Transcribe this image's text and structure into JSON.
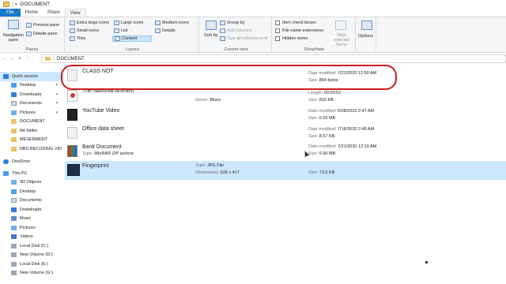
{
  "window": {
    "title": "DOCUMENT"
  },
  "tabs": [
    "File",
    "Home",
    "Share",
    "View"
  ],
  "ribbon": {
    "panes": {
      "navigation_pane": "Navigation pane",
      "preview_pane": "Preview pane",
      "details_pane": "Details pane",
      "label": "Panes"
    },
    "layout": {
      "extra_large": "Extra large icons",
      "large": "Large icons",
      "medium": "Medium icons",
      "small": "Small icons",
      "list": "List",
      "details": "Details",
      "tiles": "Tiles",
      "content": "Content",
      "label": "Layout"
    },
    "current_view": {
      "sort_by": "Sort by",
      "group_by": "Group by",
      "add_columns": "Add columns",
      "size_all": "Size all columns to fit",
      "label": "Current view"
    },
    "show_hide": {
      "item_check": "Item check boxes",
      "extensions": "File name extensions",
      "hidden_items": "Hidden items",
      "hide_selected": "Hide selected items",
      "label": "Show/hide"
    },
    "options": "Options"
  },
  "address": {
    "path": "DOCUMENT"
  },
  "nav": {
    "items": [
      {
        "label": "Quick access",
        "selected": true
      },
      {
        "label": "Desktop",
        "pinned": true
      },
      {
        "label": "Downloads",
        "pinned": true
      },
      {
        "label": "Documents",
        "pinned": true
      },
      {
        "label": "Pictures",
        "pinned": true
      },
      {
        "label": "DOCUMENT"
      },
      {
        "label": "file folder"
      },
      {
        "label": "MESERMENT"
      },
      {
        "label": "OBS RECODING VID"
      },
      {
        "label": "OneDrive"
      },
      {
        "label": "This PC"
      },
      {
        "label": "3D Objects"
      },
      {
        "label": "Desktop"
      },
      {
        "label": "Documents"
      },
      {
        "label": "Downloads"
      },
      {
        "label": "Music"
      },
      {
        "label": "Pictures"
      },
      {
        "label": "Videos"
      },
      {
        "label": "Local Disk (C:)"
      },
      {
        "label": "New Volume (D:)"
      },
      {
        "label": "Local Disk (E:)"
      },
      {
        "label": "New Volume (G:)"
      }
    ]
  },
  "files": [
    {
      "name": "CLASS NOT",
      "meta1_k": "Date modified:",
      "meta1_v": "7/21/2020 12:50 AM",
      "meta2_k": "Size:",
      "meta2_v": "864 bytes"
    },
    {
      "name": "The National Anthem",
      "mid_k": "Genre:",
      "mid_v": "Blues",
      "meta1_k": "Length:",
      "meta1_v": "00:00:52",
      "meta2_k": "Size:",
      "meta2_v": "816 KB"
    },
    {
      "name": "YouTube Video",
      "meta1_k": "Date modified:",
      "meta1_v": "6/28/2020 2:47 AM",
      "meta2_k": "Size:",
      "meta2_v": "6.03 MB"
    },
    {
      "name": "Office data sheet",
      "meta1_k": "Date modified:",
      "meta1_v": "7/16/2020 2:48 AM",
      "meta2_k": "Size:",
      "meta2_v": "8.57 KB"
    },
    {
      "name": "Bank Document",
      "sub_k": "Type:",
      "sub_v": "WinRAR ZIP archive",
      "meta1_k": "Date modified:",
      "meta1_v": "7/21/2020 12:10 AM",
      "meta2_k": "Size:",
      "meta2_v": "6.90 MB"
    },
    {
      "name": "Fingerprint",
      "mid_k": "Type:",
      "mid_v": "JPG File",
      "mid2_k": "Dimensions:",
      "mid2_v": "626 x 417",
      "meta2_k": "Size:",
      "meta2_v": "73.6 KB"
    }
  ]
}
